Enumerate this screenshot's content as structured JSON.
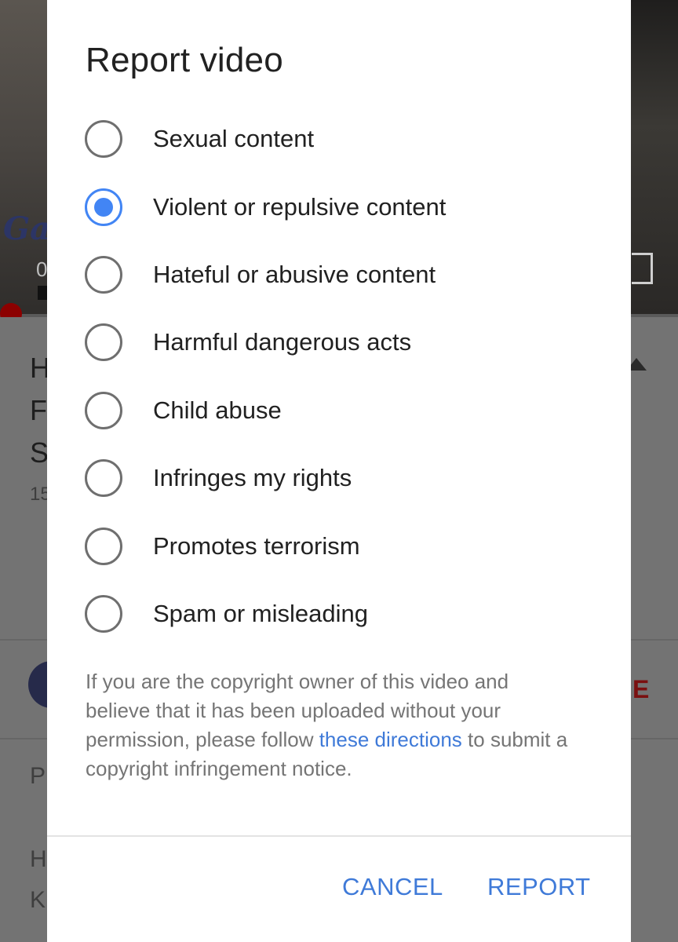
{
  "background": {
    "video_logo_text": "Ga",
    "time_partial": "0",
    "title_letters": [
      "H",
      "F",
      "S"
    ],
    "meta_partial": "15",
    "subscribe_partial": "E",
    "desc_letters": [
      "P",
      "H",
      "K"
    ]
  },
  "dialog": {
    "title": "Report video",
    "options": [
      {
        "label": "Sexual content",
        "checked": false
      },
      {
        "label": "Violent or repulsive content",
        "checked": true
      },
      {
        "label": "Hateful or abusive content",
        "checked": false
      },
      {
        "label": "Harmful dangerous acts",
        "checked": false
      },
      {
        "label": "Child abuse",
        "checked": false
      },
      {
        "label": "Infringes my rights",
        "checked": false
      },
      {
        "label": "Promotes terrorism",
        "checked": false
      },
      {
        "label": "Spam or misleading",
        "checked": false
      }
    ],
    "notice": {
      "before_link": "If you are the copyright owner of this video and believe that it has been uploaded without your permission, please follow ",
      "link_text": "these directions",
      "after_link": " to submit a copyright infringement notice."
    },
    "cancel_label": "CANCEL",
    "report_label": "REPORT"
  },
  "colors": {
    "accent": "#4285f4",
    "link": "#3f7ad8",
    "radio_unchecked": "#6f6f6f",
    "text_primary": "#212121",
    "text_secondary": "#757575"
  }
}
